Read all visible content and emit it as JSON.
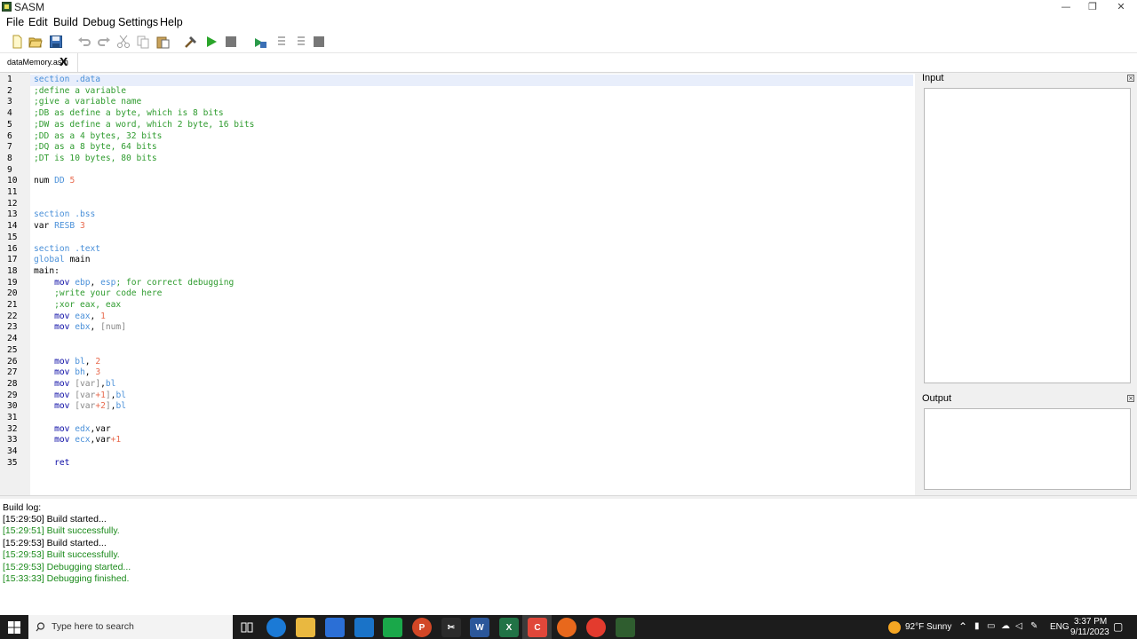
{
  "window": {
    "title": "SASM"
  },
  "menu": {
    "items": [
      "File",
      "Edit",
      "Build",
      "Debug",
      "Settings",
      "Help"
    ]
  },
  "toolbar": {
    "icons": [
      "new-file-icon",
      "open-file-icon",
      "save-icon",
      "undo-icon",
      "redo-icon",
      "cut-icon",
      "copy-icon",
      "paste-icon",
      "build-icon",
      "run-icon",
      "stop-icon",
      "debug-icon",
      "step-into-icon",
      "step-over-icon",
      "stop-debug-icon"
    ]
  },
  "tabs": [
    {
      "label": "dataMemory.asm",
      "close": "X"
    }
  ],
  "editor": {
    "lines": [
      {
        "n": "1",
        "parts": [
          [
            "kw",
            "section .data"
          ]
        ]
      },
      {
        "n": "2",
        "parts": [
          [
            "cm",
            ";define a variable"
          ]
        ]
      },
      {
        "n": "3",
        "parts": [
          [
            "cm",
            ";give a variable name"
          ]
        ]
      },
      {
        "n": "4",
        "parts": [
          [
            "cm",
            ";DB as define a byte, which is 8 bits"
          ]
        ]
      },
      {
        "n": "5",
        "parts": [
          [
            "cm",
            ";DW as define a word, which 2 byte, 16 bits"
          ]
        ]
      },
      {
        "n": "6",
        "parts": [
          [
            "cm",
            ";DD as a 4 bytes, 32 bits"
          ]
        ]
      },
      {
        "n": "7",
        "parts": [
          [
            "cm",
            ";DQ as a 8 byte, 64 bits"
          ]
        ]
      },
      {
        "n": "8",
        "parts": [
          [
            "cm",
            ";DT is 10 bytes, 80 bits"
          ]
        ]
      },
      {
        "n": "9",
        "parts": []
      },
      {
        "n": "10",
        "parts": [
          [
            "id",
            "num "
          ],
          [
            "kw",
            "DD "
          ],
          [
            "num",
            "5"
          ]
        ]
      },
      {
        "n": "11",
        "parts": []
      },
      {
        "n": "12",
        "parts": []
      },
      {
        "n": "13",
        "parts": [
          [
            "kw",
            "section .bss"
          ]
        ]
      },
      {
        "n": "14",
        "parts": [
          [
            "id",
            "var "
          ],
          [
            "kw",
            "RESB "
          ],
          [
            "num",
            "3"
          ]
        ]
      },
      {
        "n": "15",
        "parts": []
      },
      {
        "n": "16",
        "parts": [
          [
            "kw",
            "section .text"
          ]
        ]
      },
      {
        "n": "17",
        "parts": [
          [
            "kw",
            "global "
          ],
          [
            "id",
            "main"
          ]
        ]
      },
      {
        "n": "18",
        "parts": [
          [
            "id",
            "main:"
          ]
        ]
      },
      {
        "n": "19",
        "parts": [
          [
            "id",
            "    "
          ],
          [
            "ins",
            "mov "
          ],
          [
            "reg",
            "ebp"
          ],
          [
            "id",
            ", "
          ],
          [
            "reg",
            "esp"
          ],
          [
            "cm",
            "; for correct debugging"
          ]
        ]
      },
      {
        "n": "20",
        "parts": [
          [
            "cm",
            "    ;write your code here"
          ]
        ]
      },
      {
        "n": "21",
        "parts": [
          [
            "cm",
            "    ;xor eax, eax"
          ]
        ]
      },
      {
        "n": "22",
        "parts": [
          [
            "id",
            "    "
          ],
          [
            "ins",
            "mov "
          ],
          [
            "reg",
            "eax"
          ],
          [
            "id",
            ", "
          ],
          [
            "num",
            "1"
          ]
        ]
      },
      {
        "n": "23",
        "parts": [
          [
            "id",
            "    "
          ],
          [
            "ins",
            "mov "
          ],
          [
            "reg",
            "ebx"
          ],
          [
            "id",
            ", "
          ],
          [
            "br",
            "[num]"
          ]
        ]
      },
      {
        "n": "24",
        "parts": []
      },
      {
        "n": "25",
        "parts": []
      },
      {
        "n": "26",
        "parts": [
          [
            "id",
            "    "
          ],
          [
            "ins",
            "mov "
          ],
          [
            "reg",
            "bl"
          ],
          [
            "id",
            ", "
          ],
          [
            "num",
            "2"
          ]
        ]
      },
      {
        "n": "27",
        "parts": [
          [
            "id",
            "    "
          ],
          [
            "ins",
            "mov "
          ],
          [
            "reg",
            "bh"
          ],
          [
            "id",
            ", "
          ],
          [
            "num",
            "3"
          ]
        ]
      },
      {
        "n": "28",
        "parts": [
          [
            "id",
            "    "
          ],
          [
            "ins",
            "mov "
          ],
          [
            "br",
            "[var]"
          ],
          [
            "id",
            ","
          ],
          [
            "reg",
            "bl"
          ]
        ]
      },
      {
        "n": "29",
        "parts": [
          [
            "id",
            "    "
          ],
          [
            "ins",
            "mov "
          ],
          [
            "br",
            "[var"
          ],
          [
            "num",
            "+1"
          ],
          [
            "br",
            "]"
          ],
          [
            "id",
            ","
          ],
          [
            "reg",
            "bl"
          ]
        ]
      },
      {
        "n": "30",
        "parts": [
          [
            "id",
            "    "
          ],
          [
            "ins",
            "mov "
          ],
          [
            "br",
            "[var"
          ],
          [
            "num",
            "+2"
          ],
          [
            "br",
            "]"
          ],
          [
            "id",
            ","
          ],
          [
            "reg",
            "bl"
          ]
        ]
      },
      {
        "n": "31",
        "parts": []
      },
      {
        "n": "32",
        "parts": [
          [
            "id",
            "    "
          ],
          [
            "ins",
            "mov "
          ],
          [
            "reg",
            "edx"
          ],
          [
            "id",
            ",var"
          ]
        ]
      },
      {
        "n": "33",
        "parts": [
          [
            "id",
            "    "
          ],
          [
            "ins",
            "mov "
          ],
          [
            "reg",
            "ecx"
          ],
          [
            "id",
            ",var"
          ],
          [
            "num",
            "+1"
          ]
        ]
      },
      {
        "n": "34",
        "parts": []
      },
      {
        "n": "35",
        "parts": [
          [
            "id",
            "    "
          ],
          [
            "ins",
            "ret"
          ]
        ]
      }
    ]
  },
  "panels": {
    "input_title": "Input",
    "output_title": "Output"
  },
  "build_log": {
    "title": "Build log:",
    "entries": [
      {
        "text": "[15:29:50] Build started...",
        "color": "#000000"
      },
      {
        "text": "[15:29:51] Built successfully.",
        "color": "#1a8a1a"
      },
      {
        "text": "[15:29:53] Build started...",
        "color": "#000000"
      },
      {
        "text": "[15:29:53] Built successfully.",
        "color": "#1a8a1a"
      },
      {
        "text": "[15:29:53] Debugging started...",
        "color": "#1a8a1a"
      },
      {
        "text": "[15:33:33] Debugging finished.",
        "color": "#1a8a1a"
      }
    ]
  },
  "taskbar": {
    "search_placeholder": "Type here to search",
    "weather": "92°F  Sunny",
    "language": "ENG",
    "time": "3:37 PM",
    "date": "9/11/2023"
  },
  "colors": {
    "keyword": "#4a90d9",
    "comment": "#2e9b2e",
    "number": "#e86b4f",
    "instruction": "#0a0aa5",
    "success": "#1a8a1a"
  }
}
